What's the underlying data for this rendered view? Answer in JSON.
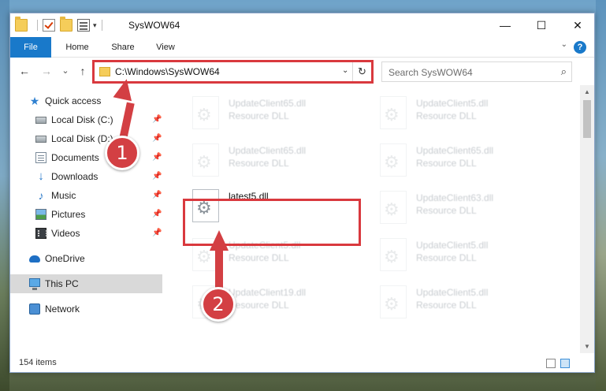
{
  "window": {
    "title": "SysWOW64",
    "minimize": "—",
    "maximize": "☐",
    "close": "✕"
  },
  "ribbon": {
    "tabs": [
      "File",
      "Home",
      "Share",
      "View"
    ],
    "help": "?"
  },
  "navigation": {
    "back": "←",
    "forward": "→",
    "recent": "⌄",
    "up": "↑",
    "address": "C:\\Windows\\SysWOW64",
    "search_placeholder": "Search SysWOW64"
  },
  "sidebar": {
    "items": [
      {
        "label": "Quick access",
        "icon": "star-icon",
        "pinned": false
      },
      {
        "label": "Local Disk (C:)",
        "icon": "disk-icon",
        "pinned": true
      },
      {
        "label": "Local Disk (D:)",
        "icon": "disk-icon",
        "pinned": true
      },
      {
        "label": "Documents",
        "icon": "documents-icon",
        "pinned": true
      },
      {
        "label": "Downloads",
        "icon": "download-icon",
        "pinned": true
      },
      {
        "label": "Music",
        "icon": "music-icon",
        "pinned": true
      },
      {
        "label": "Pictures",
        "icon": "pictures-icon",
        "pinned": true
      },
      {
        "label": "Videos",
        "icon": "videos-icon",
        "pinned": true
      },
      {
        "label": "OneDrive",
        "icon": "cloud-icon",
        "pinned": false
      },
      {
        "label": "This PC",
        "icon": "computer-icon",
        "pinned": false,
        "selected": true
      },
      {
        "label": "Network",
        "icon": "network-icon",
        "pinned": false
      }
    ]
  },
  "files": [
    {
      "name": "UpdateClient65.dll",
      "type": "Resource DLL",
      "blurred": true
    },
    {
      "name": "UpdateClient5.dll",
      "type": "Resource DLL",
      "blurred": true
    },
    {
      "name": "UpdateClient65.dll",
      "type": "Resource DLL",
      "blurred": true
    },
    {
      "name": "UpdateClient65.dll",
      "type": "Resource DLL",
      "blurred": true
    },
    {
      "name": "latest5.dll",
      "type": "",
      "blurred": false
    },
    {
      "name": "UpdateClient63.dll",
      "type": "Resource DLL",
      "blurred": true
    },
    {
      "name": "UpdateClient5.dll",
      "type": "Resource DLL",
      "blurred": true
    },
    {
      "name": "UpdateClient5.dll",
      "type": "Resource DLL",
      "blurred": true
    },
    {
      "name": "UpdateClient19.dll",
      "type": "Resource DLL",
      "blurred": true
    },
    {
      "name": "UpdateClient5.dll",
      "type": "Resource DLL",
      "blurred": true
    }
  ],
  "status": {
    "item_count": "154 items"
  },
  "annotations": {
    "marker1": "1",
    "marker2": "2",
    "highlight_color": "#d9393e"
  },
  "colors": {
    "accent": "#1979ca",
    "selection": "#d9d9d9"
  }
}
